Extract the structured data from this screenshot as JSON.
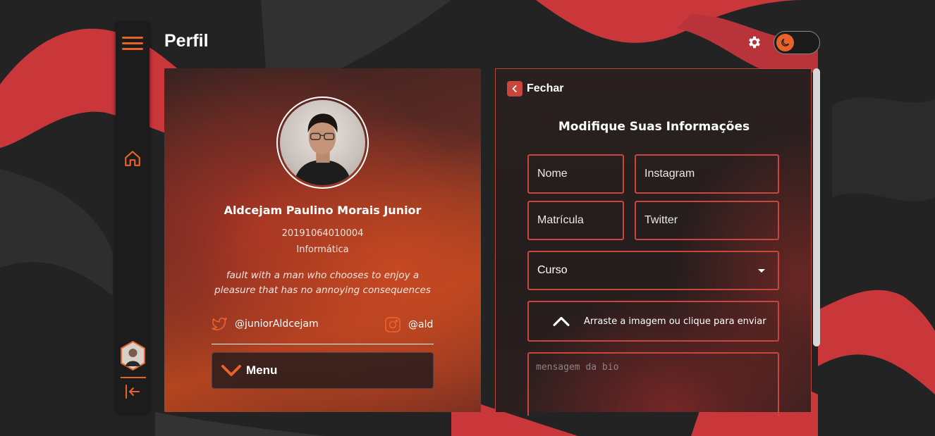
{
  "header": {
    "title": "Perfil"
  },
  "colors": {
    "accent": "#e8622a",
    "field_border": "#c9463f",
    "background": "#232323"
  },
  "icons": {
    "sidebar": [
      "menu-icon",
      "home-icon",
      "avatar",
      "logout-icon"
    ],
    "header": [
      "gear-icon",
      "moon-icon"
    ]
  },
  "profile": {
    "name": "Aldcejam Paulino Morais Junior",
    "registration": "20191064010004",
    "course": "Informática",
    "bio": "fault with a man who chooses to enjoy a pleasure that has no annoying consequences",
    "twitter": "@juniorAldcejam",
    "instagram": "@ald",
    "menu_label": "Menu"
  },
  "edit_form": {
    "close_label": "Fechar",
    "title": "Modifique Suas Informações",
    "name_placeholder": "Nome",
    "instagram_placeholder": "Instagram",
    "registration_placeholder": "Matrícula",
    "twitter_placeholder": "Twitter",
    "course_select": "Curso",
    "upload_label": "Arraste a imagem ou clique para enviar",
    "bio_placeholder": "mensagem da bio"
  }
}
